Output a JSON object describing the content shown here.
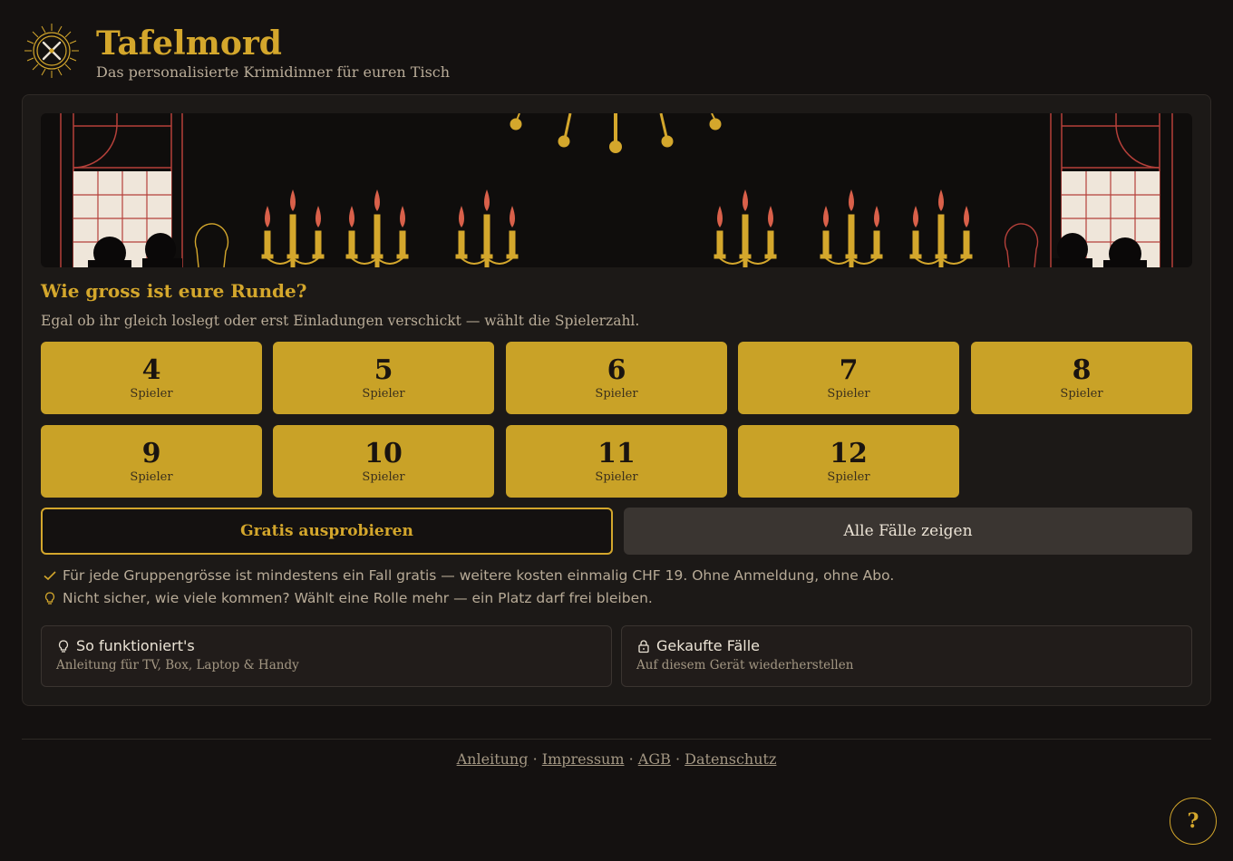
{
  "header": {
    "title": "Tafelmord",
    "subtitle": "Das personalisierte Krimidinner für euren Tisch",
    "logo_icon": "dagger-fork-crest-icon"
  },
  "colors": {
    "accent": "#d4a72c",
    "button_fill": "#c9a227",
    "background": "#141110",
    "card": "#1c1917",
    "candle_flame": "#d9604a"
  },
  "question": {
    "title": "Wie gross ist eure Runde?",
    "subtitle": "Egal ob ihr gleich loslegt oder erst Einladungen verschickt — wählt die Spielerzahl."
  },
  "players": [
    {
      "count": "4",
      "label": "Spieler"
    },
    {
      "count": "5",
      "label": "Spieler"
    },
    {
      "count": "6",
      "label": "Spieler"
    },
    {
      "count": "7",
      "label": "Spieler"
    },
    {
      "count": "8",
      "label": "Spieler"
    },
    {
      "count": "9",
      "label": "Spieler"
    },
    {
      "count": "10",
      "label": "Spieler"
    },
    {
      "count": "11",
      "label": "Spieler"
    },
    {
      "count": "12",
      "label": "Spieler"
    }
  ],
  "actions": {
    "try_free": "Gratis ausprobieren",
    "show_all": "Alle Fälle zeigen"
  },
  "notes": [
    {
      "icon": "check-icon",
      "text": "Für jede Gruppengrösse ist mindestens ein Fall gratis — weitere kosten einmalig CHF 19. Ohne Anmeldung, ohne Abo."
    },
    {
      "icon": "lightbulb-icon",
      "text": "Nicht sicher, wie viele kommen? Wählt eine Rolle mehr — ein Platz darf frei bleiben."
    }
  ],
  "info_cards": {
    "how": {
      "icon": "lightbulb-icon",
      "title": "So funktioniert's",
      "subtitle": "Anleitung für TV, Box, Laptop & Handy"
    },
    "purchased": {
      "icon": "lock-icon",
      "title": "Gekaufte Fälle",
      "subtitle": "Auf diesem Gerät wiederherstellen"
    }
  },
  "footer": {
    "links": [
      "Anleitung",
      "Impressum",
      "AGB",
      "Datenschutz"
    ],
    "separator": "·"
  },
  "help": {
    "label": "?"
  }
}
